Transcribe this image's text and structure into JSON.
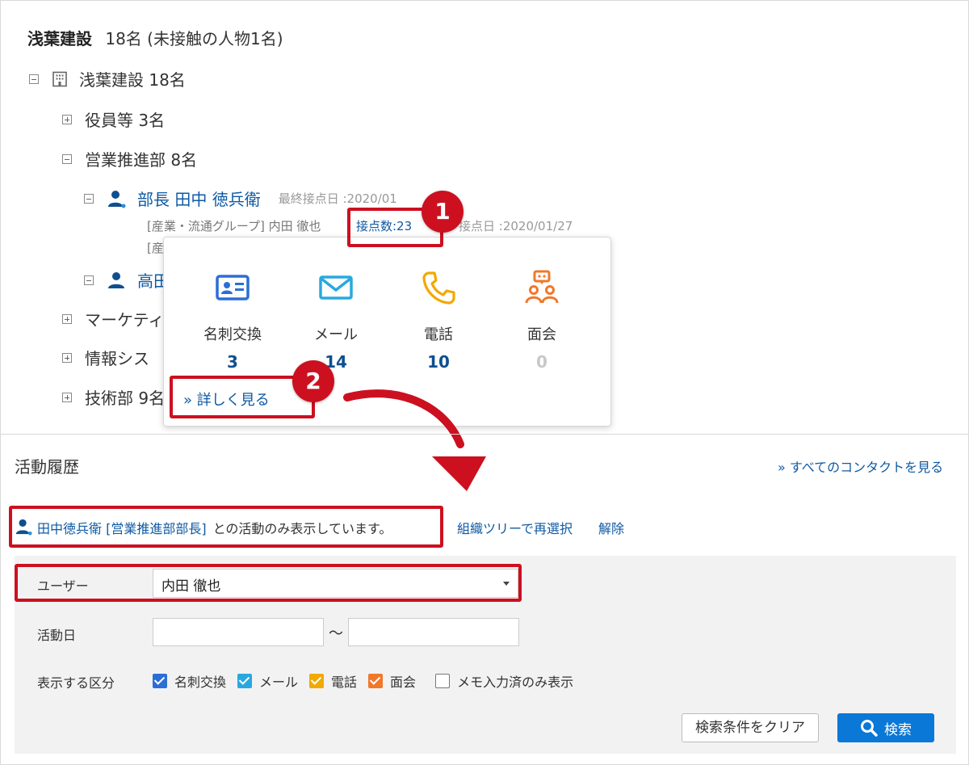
{
  "org": {
    "header_name": "浅葉建設",
    "header_count": "18名 (未接触の人物1名)",
    "root_label": "浅葉建設 18名",
    "nodes": {
      "officers": "役員等 3名",
      "sales": "営業推進部 8名",
      "marketing": "マーケティ",
      "infosys": "情報シス",
      "tech": "技術部 9名"
    },
    "person1": {
      "name": "部長 田中 徳兵衛",
      "last_contact": "最終接点日 :2020/01",
      "dept_line": "[産業・流通グループ]  内田 徹也",
      "contact_count": "接点数:23",
      "last_contact_2": "接点日 :2020/01/27",
      "dept_line_2": "[産"
    },
    "person2": {
      "name": "高田"
    }
  },
  "popup": {
    "stats": [
      {
        "label": "名刺交換",
        "value": "3",
        "icon": "business-card-icon",
        "color": "#2b6fd6"
      },
      {
        "label": "メール",
        "value": "14",
        "icon": "mail-icon",
        "color": "#29a8e0"
      },
      {
        "label": "電話",
        "value": "10",
        "icon": "phone-icon",
        "color": "#f2a900"
      },
      {
        "label": "面会",
        "value": "0",
        "icon": "meeting-icon",
        "color": "#f0782a"
      }
    ],
    "more_link": "»  詳しく見る"
  },
  "callouts": {
    "one": "1",
    "two": "2",
    "color": "#cc1020"
  },
  "activity": {
    "title": "活動履歴",
    "see_all": "»  すべてのコンタクトを見る",
    "filter_person": "田中徳兵衛 [営業推進部部長]",
    "filter_suffix": "との活動のみ表示しています。",
    "reselect": "組織ツリーで再選択",
    "release": "解除"
  },
  "search": {
    "user_label": "ユーザー",
    "user_value": "内田 徹也",
    "date_label": "活動日",
    "date_sep": "〜",
    "category_label": "表示する区分",
    "categories": [
      {
        "label": "名刺交換",
        "checked": true,
        "color": "#2b6fd6"
      },
      {
        "label": "メール",
        "checked": true,
        "color": "#29a8e0"
      },
      {
        "label": "電話",
        "checked": true,
        "color": "#f2a900"
      },
      {
        "label": "面会",
        "checked": true,
        "color": "#f0782a"
      },
      {
        "label": "メモ入力済のみ表示",
        "checked": false
      }
    ],
    "clear_button": "検索条件をクリア",
    "search_button": "検索"
  }
}
